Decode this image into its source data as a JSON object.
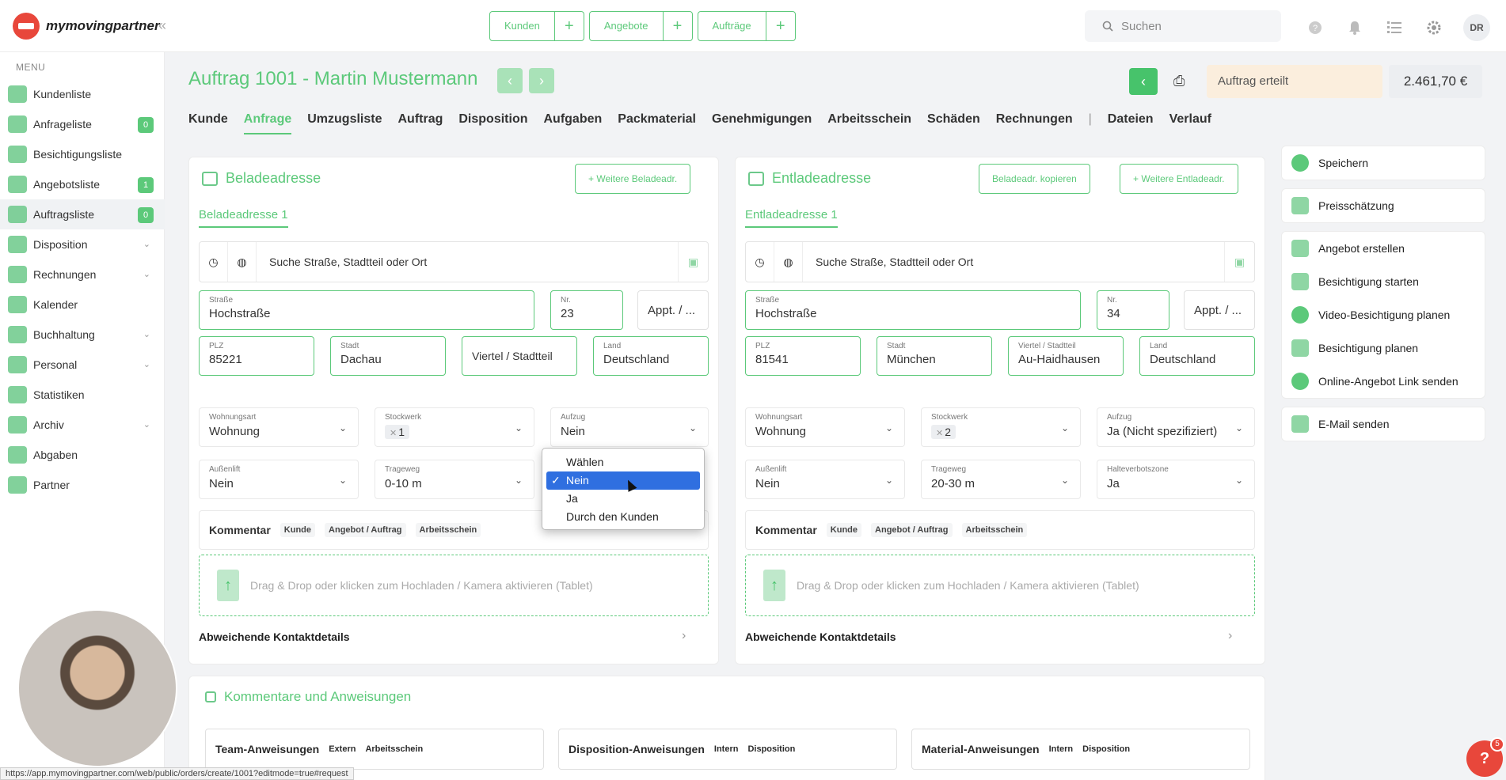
{
  "brand": {
    "name": "mymovingpartner"
  },
  "topbar": {
    "quick": [
      {
        "label": "Kunden"
      },
      {
        "label": "Angebote"
      },
      {
        "label": "Aufträge"
      }
    ],
    "plus_glyph": "+",
    "search_placeholder": "Suchen",
    "avatar_initials": "DR"
  },
  "sidebar": {
    "title": "MENU",
    "items": [
      {
        "label": "Kundenliste"
      },
      {
        "label": "Anfrageliste",
        "badge": "0"
      },
      {
        "label": "Besichtigungsliste"
      },
      {
        "label": "Angebotsliste",
        "badge": "1"
      },
      {
        "label": "Auftragsliste",
        "badge": "0"
      },
      {
        "label": "Disposition"
      },
      {
        "label": "Rechnungen"
      },
      {
        "label": "Kalender"
      },
      {
        "label": "Buchhaltung"
      },
      {
        "label": "Personal"
      },
      {
        "label": "Statistiken"
      },
      {
        "label": "Archiv"
      },
      {
        "label": "Abgaben"
      },
      {
        "label": "Partner"
      }
    ]
  },
  "header": {
    "title": "Auftrag 1001 - Martin Mustermann",
    "status": "Auftrag erteilt",
    "price": "2.461,70 €"
  },
  "tabs": [
    "Kunde",
    "Anfrage",
    "Umzugsliste",
    "Auftrag",
    "Disposition",
    "Aufgaben",
    "Packmaterial",
    "Genehmigungen",
    "Arbeitsschein",
    "Schäden",
    "Rechnungen",
    "|",
    "Dateien",
    "Verlauf"
  ],
  "labels": {
    "search_address": "Suche Straße, Stadtteil oder Ort",
    "strasse": "Straße",
    "nr": "Nr.",
    "appt": "Appt. / ...",
    "plz": "PLZ",
    "stadt": "Stadt",
    "viertel_ph": "Viertel / Stadtteil",
    "viertel": "Viertel / Stadtteil",
    "land": "Land",
    "wohnungsart": "Wohnungsart",
    "stockwerk": "Stockwerk",
    "aufzug": "Aufzug",
    "aussenlift": "Außenlift",
    "trageweg": "Trageweg",
    "halteverbot": "Halteverbotszone",
    "kommentar": "Kommentar",
    "tag_kunde": "Kunde",
    "tag_angebot": "Angebot / Auftrag",
    "tag_arbeitsschein": "Arbeitsschein",
    "dropzone": "Drag & Drop oder klicken zum Hochladen / Kamera aktivieren (Tablet)",
    "contact": "Abweichende Kontaktdetails"
  },
  "beladung": {
    "title": "Beladeadresse",
    "btn_more": "+ Weitere Beladeadr.",
    "subtab": "Beladeadresse 1",
    "strasse": "Hochstraße",
    "nr": "23",
    "plz": "85221",
    "stadt": "Dachau",
    "land": "Deutschland",
    "wohnungsart": "Wohnung",
    "stockwerk": "1",
    "aufzug": "Nein",
    "aussenlift": "Nein",
    "trageweg": "0-10 m"
  },
  "entladung": {
    "title": "Entladeadresse",
    "btn_copy": "Beladeadr. kopieren",
    "btn_more": "+ Weitere Entladeadr.",
    "subtab": "Entladeadresse 1",
    "strasse": "Hochstraße",
    "nr": "34",
    "plz": "81541",
    "stadt": "München",
    "viertel": "Au-Haidhausen",
    "land": "Deutschland",
    "wohnungsart": "Wohnung",
    "stockwerk": "2",
    "aufzug": "Ja (Nicht spezifiziert)",
    "aussenlift": "Nein",
    "trageweg": "20-30 m",
    "halteverbot": "Ja"
  },
  "dropdown": {
    "options": [
      "Wählen",
      "Nein",
      "Ja",
      "Durch den Kunden"
    ],
    "selected": "Nein",
    "check_glyph": "✓"
  },
  "actions": {
    "primary": [
      {
        "label": "Speichern",
        "icon": "check-icon"
      },
      {
        "label": "Preisschätzung",
        "icon": "calculator-icon"
      }
    ],
    "secondary": [
      {
        "label": "Angebot erstellen",
        "icon": "document-icon"
      },
      {
        "label": "Besichtigung starten",
        "icon": "house-icon"
      },
      {
        "label": "Video-Besichtigung planen",
        "icon": "video-icon"
      },
      {
        "label": "Besichtigung planen",
        "icon": "person-icon"
      },
      {
        "label": "Online-Angebot Link senden",
        "icon": "link-icon"
      }
    ],
    "tertiary": [
      {
        "label": "E-Mail senden",
        "icon": "mail-icon"
      }
    ]
  },
  "comments_section": {
    "title": "Kommentare und Anweisungen",
    "items": [
      {
        "label": "Team-Anweisungen",
        "tag1": "Extern",
        "tag2": "Arbeitsschein"
      },
      {
        "label": "Disposition-Anweisungen",
        "tag1": "Intern",
        "tag2": "Disposition"
      },
      {
        "label": "Material-Anweisungen",
        "tag1": "Intern",
        "tag2": "Disposition"
      }
    ]
  },
  "help": {
    "glyph": "?",
    "badge": "5"
  },
  "status_url": "https://app.mymovingpartner.com/web/public/orders/create/1001?editmode=true#request",
  "colors": {
    "accent": "#5cc97a",
    "status_bg": "#fbeedd",
    "selection": "#2f6fe0",
    "brand_red": "#e8473b"
  }
}
